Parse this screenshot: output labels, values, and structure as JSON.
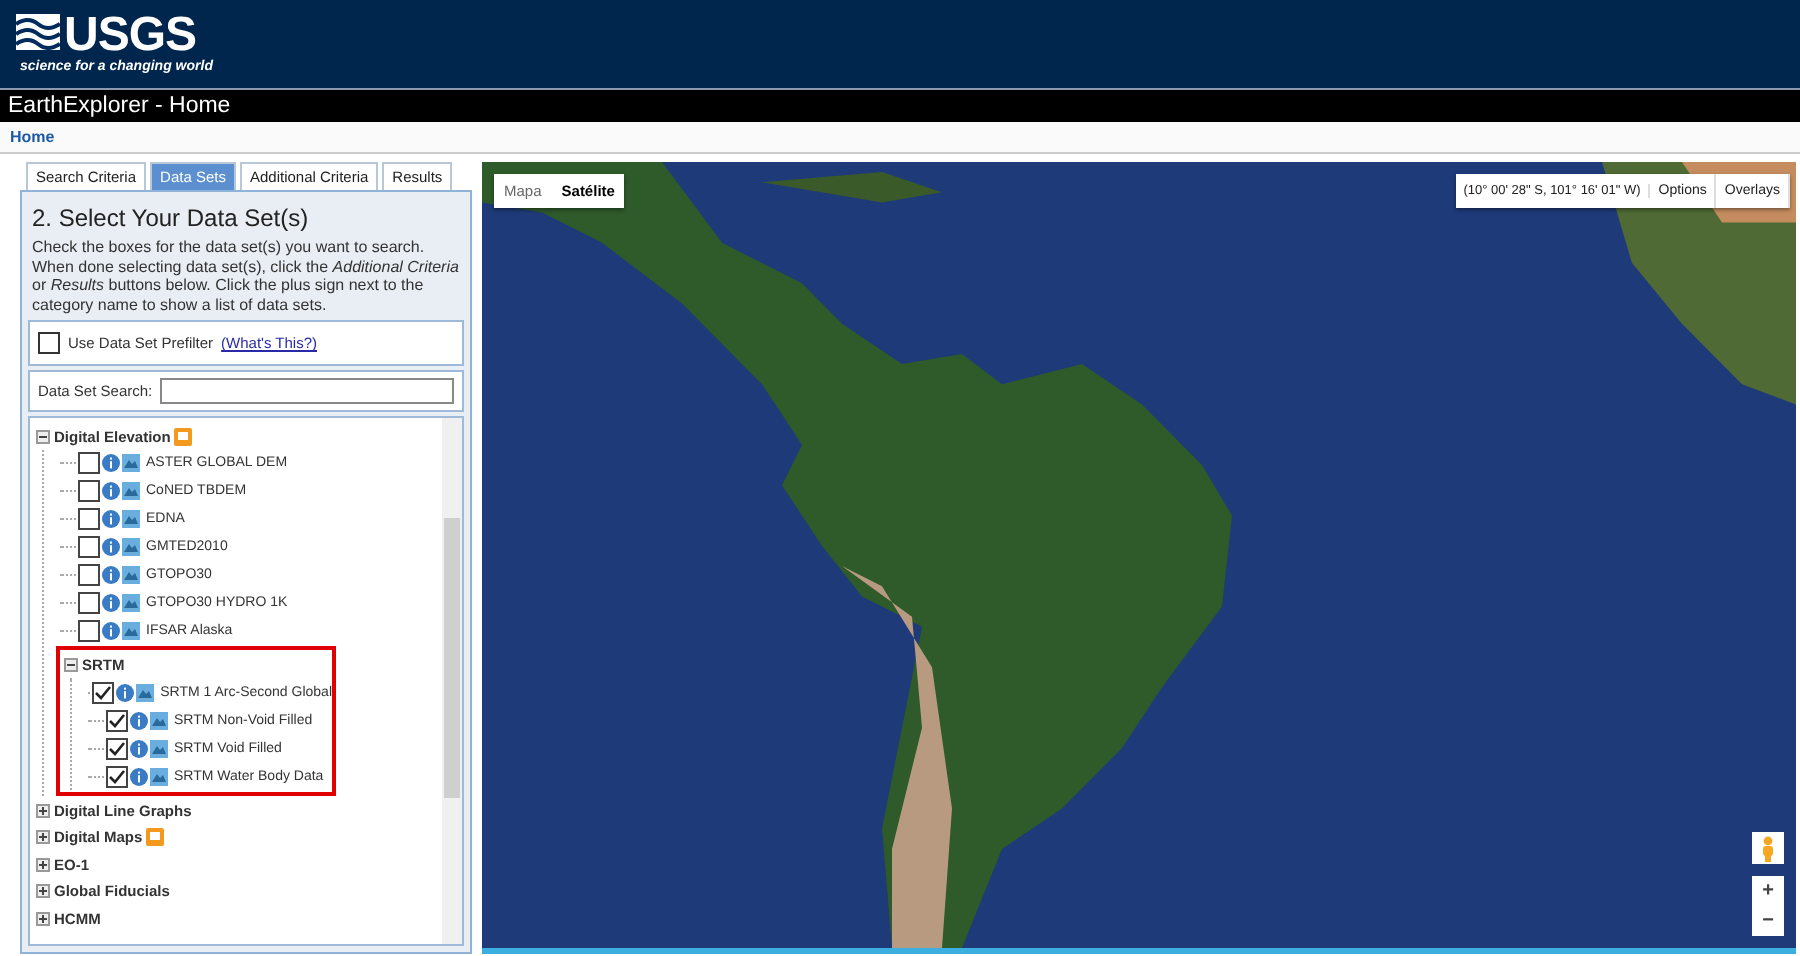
{
  "header": {
    "logo_text": "USGS",
    "tagline": "science for a changing world"
  },
  "title_bar": {
    "title": "EarthExplorer - Home"
  },
  "breadcrumb": {
    "link": "Home"
  },
  "tabs": [
    {
      "label": "Search Criteria",
      "selected": false
    },
    {
      "label": "Data Sets",
      "selected": true
    },
    {
      "label": "Additional Criteria",
      "selected": false
    },
    {
      "label": "Results",
      "selected": false
    }
  ],
  "panel": {
    "heading": "2. Select Your Data Set(s)",
    "description": "Check the boxes for the data set(s) you want to search. When done selecting data set(s), click the *Additional Criteria* or *Results* buttons below. Click the plus sign next to the category name to show a list of data sets.",
    "prefilter": {
      "label": "Use Data Set Prefilter",
      "checked": false,
      "link": "(What's This?)"
    },
    "search": {
      "label": "Data Set Search:"
    }
  },
  "tree": [
    {
      "label": "Digital Elevation",
      "expanded": true,
      "badge": true,
      "highlighted": false,
      "children": [
        {
          "label": "ASTER GLOBAL DEM",
          "checked": false
        },
        {
          "label": "CoNED TBDEM",
          "checked": false
        },
        {
          "label": "EDNA",
          "checked": false
        },
        {
          "label": "GMTED2010",
          "checked": false
        },
        {
          "label": "GTOPO30",
          "checked": false
        },
        {
          "label": "GTOPO30 HYDRO 1K",
          "checked": false
        },
        {
          "label": "IFSAR Alaska",
          "checked": false
        },
        {
          "label": "SRTM",
          "expanded": true,
          "badge": false,
          "highlighted": true,
          "children": [
            {
              "label": "SRTM 1 Arc-Second Global",
              "checked": true
            },
            {
              "label": "SRTM Non-Void Filled",
              "checked": true
            },
            {
              "label": "SRTM Void Filled",
              "checked": true
            },
            {
              "label": "SRTM Water Body Data",
              "checked": true
            }
          ]
        }
      ]
    },
    {
      "label": "Digital Line Graphs",
      "expanded": false,
      "badge": false,
      "highlighted": false
    },
    {
      "label": "Digital Maps",
      "expanded": false,
      "badge": true,
      "highlighted": false
    },
    {
      "label": "EO-1",
      "expanded": false,
      "badge": false,
      "highlighted": false
    },
    {
      "label": "Global Fiducials",
      "expanded": false,
      "badge": false,
      "highlighted": false
    },
    {
      "label": "HCMM",
      "expanded": false,
      "badge": false,
      "highlighted": false
    }
  ],
  "map": {
    "map_types": [
      {
        "label": "Mapa",
        "selected": false
      },
      {
        "label": "Satélite",
        "selected": true
      }
    ],
    "coordinates": "(10° 00' 28\" S, 101° 16' 01\" W)",
    "buttons": [
      "Options",
      "Overlays"
    ],
    "zoom_in": "+",
    "zoom_out": "−"
  }
}
